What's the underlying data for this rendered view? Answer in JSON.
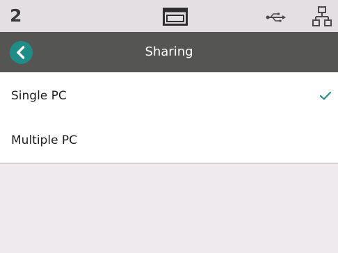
{
  "status_bar": {
    "number": "2",
    "icons": [
      "display-icon",
      "usb-icon",
      "network-icon"
    ]
  },
  "header": {
    "title": "Sharing",
    "back_icon": "chevron-left-icon",
    "back_color": "#1e8d87"
  },
  "options": [
    {
      "label": "Single PC",
      "selected": true
    },
    {
      "label": "Multiple PC",
      "selected": false
    }
  ],
  "colors": {
    "header_bg": "#555654",
    "accent": "#1e8d87",
    "check": "#2a8f89"
  }
}
